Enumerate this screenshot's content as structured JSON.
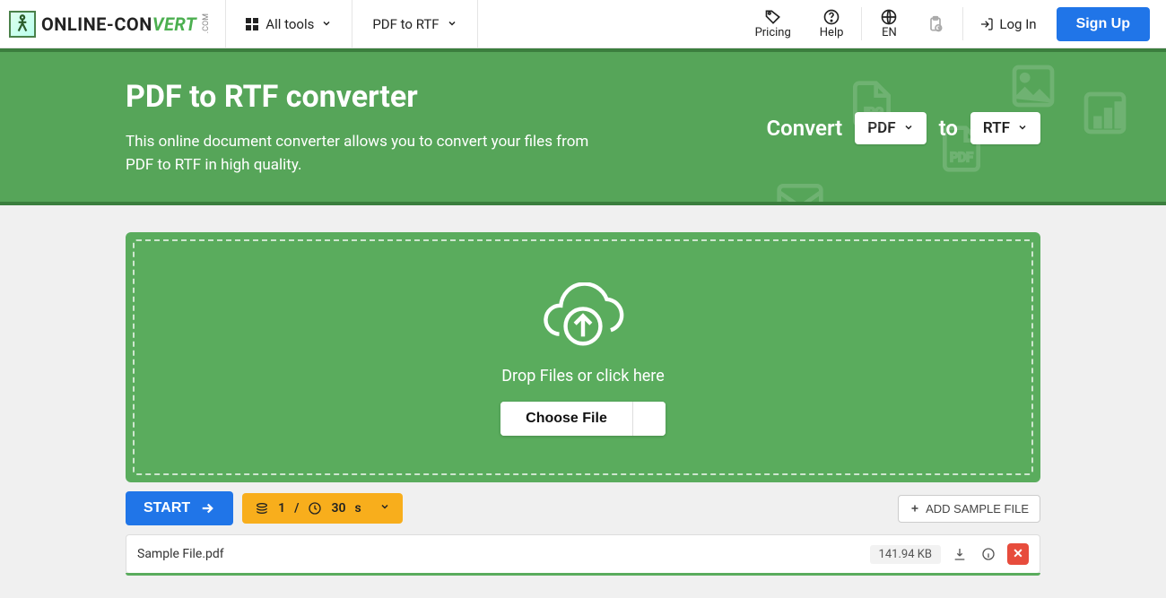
{
  "brand": {
    "online": "ONLINE-",
    "con": "CON",
    "vert": "VERT",
    "com": ".COM"
  },
  "nav": {
    "all_tools": "All tools",
    "breadcrumb": "PDF to RTF"
  },
  "top": {
    "pricing": "Pricing",
    "help": "Help",
    "lang": "EN",
    "login": "Log In",
    "signup": "Sign Up"
  },
  "hero": {
    "title": "PDF to RTF converter",
    "desc": "This online document converter allows you to convert your files from PDF to RTF in high quality.",
    "convert_label": "Convert",
    "from_value": "PDF",
    "to_label": "to",
    "to_value": "RTF"
  },
  "drop": {
    "text": "Drop Files or click here",
    "choose": "Choose File"
  },
  "actions": {
    "start": "START",
    "count": "1",
    "slash": "/",
    "time": "30",
    "unit": "s",
    "add_sample": "ADD SAMPLE FILE"
  },
  "file": {
    "name": "Sample File.pdf",
    "size": "141.94 KB",
    "remove": "✕"
  }
}
